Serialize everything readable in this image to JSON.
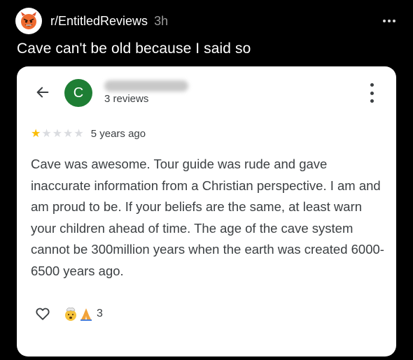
{
  "post": {
    "subreddit": "r/EntitledReviews",
    "age": "3h",
    "title": "Cave can't be old because I said so",
    "more_icon": "more-horizontal-icon"
  },
  "review": {
    "avatar_letter": "C",
    "reviewer_count": "3 reviews",
    "rating": 1,
    "max_rating": 5,
    "star_filled_color": "#fbbc04",
    "star_empty_color": "#dadce0",
    "age": "5 years ago",
    "text": "Cave was awesome. Tour guide was rude and gave inaccurate information from a Christian perspective. I am and am proud to be. If your beliefs are the same, at least warn your children ahead of time. The age of the cave system cannot be 300million years when the earth was created 6000-6500 years ago.",
    "reaction_count": "3"
  },
  "colors": {
    "background": "#000000",
    "card": "#ffffff",
    "avatar_green": "#1e7e34",
    "text_dark": "#3c4043"
  }
}
